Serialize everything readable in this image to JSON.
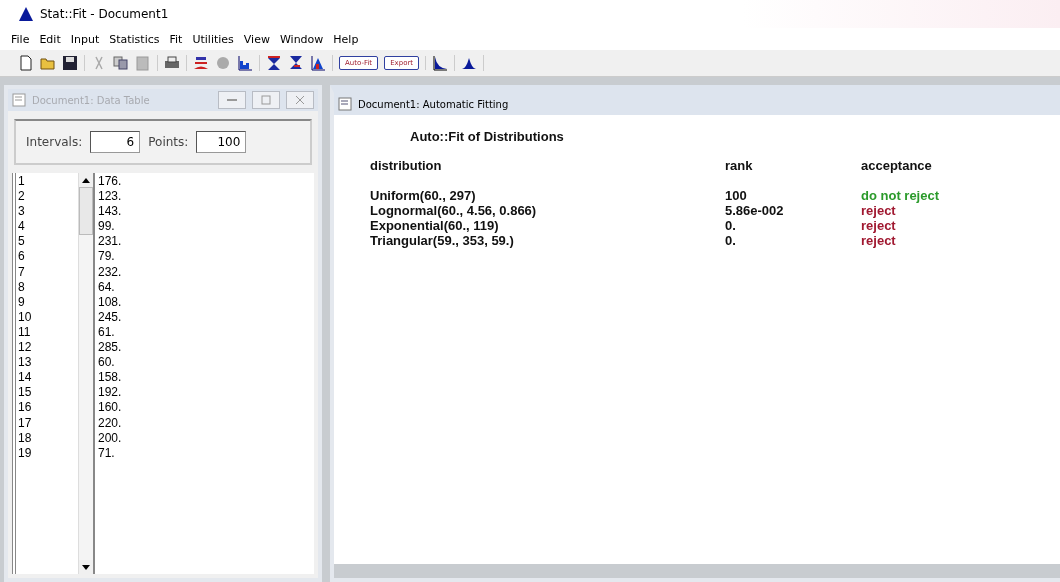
{
  "window": {
    "title": "Stat::Fit - Document1"
  },
  "menu": [
    "File",
    "Edit",
    "Input",
    "Statistics",
    "Fit",
    "Utilities",
    "View",
    "Window",
    "Help"
  ],
  "toolbar": {
    "text_buttons": [
      "Auto-Fit",
      "Export"
    ]
  },
  "data_window": {
    "title": "Document1: Data Table",
    "active": false,
    "intervals_label": "Intervals:",
    "intervals": "6",
    "points_label": "Points:",
    "points": "100",
    "rows": [
      {
        "index": "1",
        "value": "176."
      },
      {
        "index": "2",
        "value": "123."
      },
      {
        "index": "3",
        "value": "143."
      },
      {
        "index": "4",
        "value": "99."
      },
      {
        "index": "5",
        "value": "231."
      },
      {
        "index": "6",
        "value": "79."
      },
      {
        "index": "7",
        "value": "232."
      },
      {
        "index": "8",
        "value": "64."
      },
      {
        "index": "9",
        "value": "108."
      },
      {
        "index": "10",
        "value": "245."
      },
      {
        "index": "11",
        "value": "61."
      },
      {
        "index": "12",
        "value": "285."
      },
      {
        "index": "13",
        "value": "60."
      },
      {
        "index": "14",
        "value": "158."
      },
      {
        "index": "15",
        "value": "192."
      },
      {
        "index": "16",
        "value": "160."
      },
      {
        "index": "17",
        "value": "220."
      },
      {
        "index": "18",
        "value": "200."
      },
      {
        "index": "19",
        "value": "71."
      }
    ]
  },
  "fit_window": {
    "title": "Document1: Automatic Fitting",
    "active": true,
    "heading": "Auto::Fit of Distributions",
    "columns": [
      "distribution",
      "rank",
      "acceptance"
    ],
    "rows": [
      {
        "distribution": "Uniform(60., 297)",
        "rank": "100",
        "acceptance": "do not reject",
        "accepted": true
      },
      {
        "distribution": "Lognormal(60., 4.56, 0.866)",
        "rank": "5.86e-002",
        "acceptance": "reject",
        "accepted": false
      },
      {
        "distribution": "Exponential(60., 119)",
        "rank": "0.",
        "acceptance": "reject",
        "accepted": false
      },
      {
        "distribution": "Triangular(59., 353, 59.)",
        "rank": "0.",
        "acceptance": "reject",
        "accepted": false
      }
    ]
  }
}
